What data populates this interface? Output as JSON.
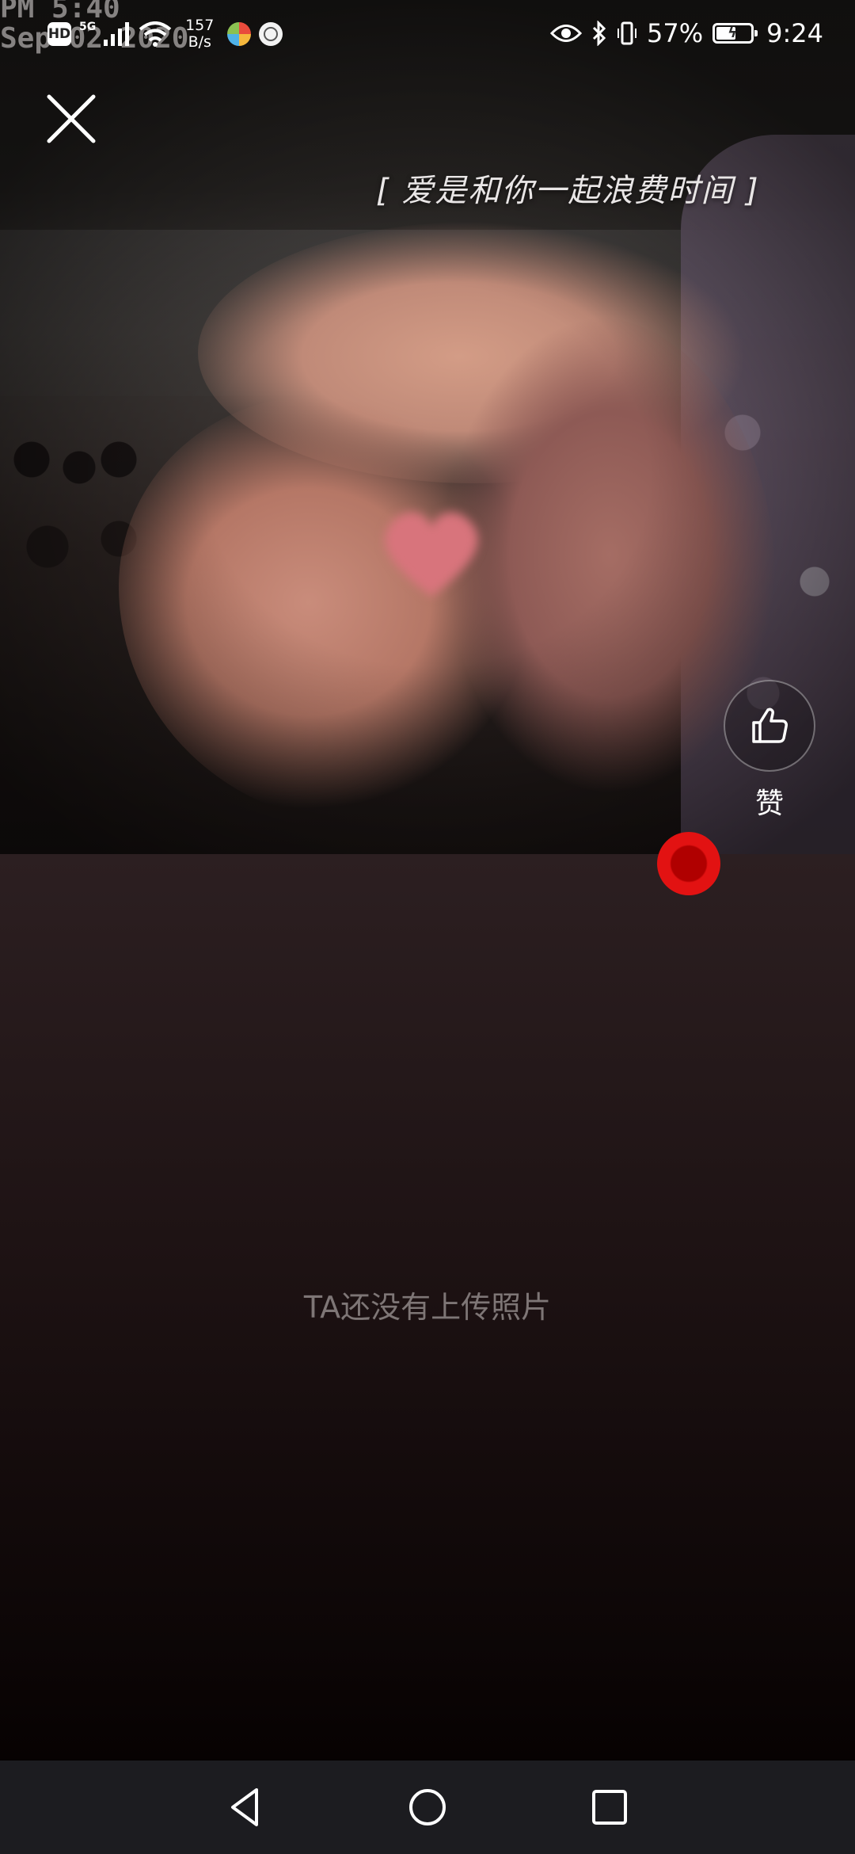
{
  "status_bar": {
    "photo_stamp_line1": "PM 5:40",
    "photo_stamp_line2": "Sep 02 2020",
    "hd_badge": "HD",
    "network_type": "5G",
    "net_speed_value": "157",
    "net_speed_unit": "B/s",
    "battery_percent": "57%",
    "battery_level": 0.57,
    "time": "9:24",
    "icons": [
      "hd-icon",
      "signal-icon",
      "wifi-icon",
      "app-notification-icon",
      "app-notification-icon",
      "eye-icon",
      "bluetooth-icon",
      "vibrate-icon",
      "battery-charging-icon"
    ]
  },
  "photo": {
    "caption": "[ 爱是和你一起浪费时间 ]"
  },
  "controls": {
    "close_icon": "close-icon",
    "like_icon": "thumbs-up-icon",
    "like_label": "赞",
    "record_color": "#e21212"
  },
  "empty_state": {
    "message": "TA还没有上传照片"
  },
  "nav_bar": {
    "buttons": [
      "back-icon",
      "home-icon",
      "recents-icon"
    ]
  },
  "colors": {
    "background_top": "#2c1f21",
    "background_bottom": "#050101",
    "accent_red": "#e21212",
    "nav_bar": "#1c1c20"
  }
}
